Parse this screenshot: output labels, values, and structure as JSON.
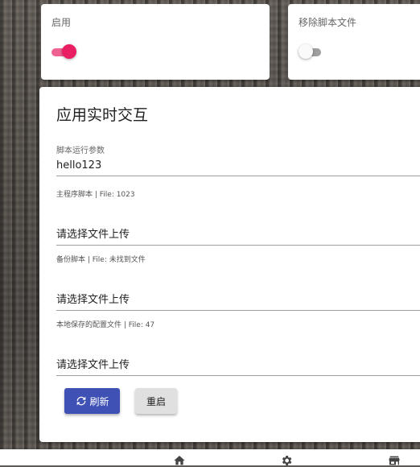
{
  "switches": [
    {
      "title": "启用",
      "checked": true,
      "accent": "#e91e63"
    },
    {
      "title": "移除脚本文件",
      "checked": false
    }
  ],
  "form": {
    "title": "应用实时交互",
    "run_param": {
      "label": "脚本运行参数",
      "value": "hello123"
    },
    "main_script": {
      "hint": "主程序脚本 | File: 1023",
      "placeholder": "请选择文件上传"
    },
    "backup_script": {
      "hint": "备份脚本 | File: 未找到文件",
      "placeholder": "请选择文件上传"
    },
    "local_config": {
      "hint": "本地保存的配置文件 | File: 47",
      "placeholder": "请选择文件上传"
    },
    "refresh_label": "刷新",
    "restart_label": "重启"
  },
  "bottom_nav": [
    {
      "icon": "home-icon"
    },
    {
      "icon": "gear-icon"
    },
    {
      "icon": "store-icon"
    }
  ],
  "colors": {
    "primary": "#3f51b5",
    "accent": "#e91e63"
  }
}
